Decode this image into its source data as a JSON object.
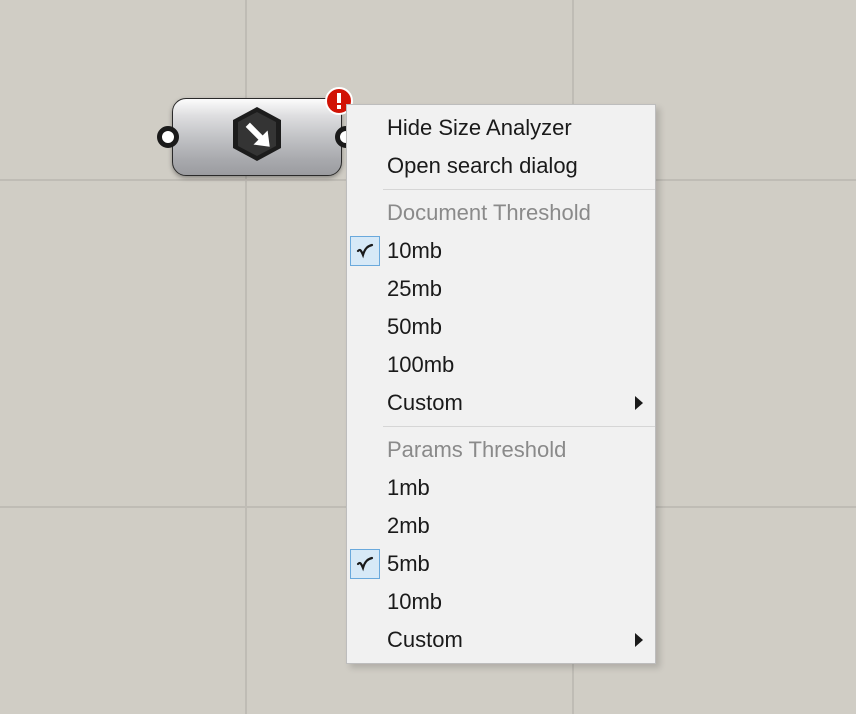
{
  "menu": {
    "hide": "Hide Size Analyzer",
    "opensearch": "Open search dialog",
    "docHeader": "Document Threshold",
    "docItems": [
      "10mb",
      "25mb",
      "50mb",
      "100mb"
    ],
    "docCustom": "Custom",
    "docChecked": 0,
    "paramsHeader": "Params Threshold",
    "paramsItems": [
      "1mb",
      "2mb",
      "5mb",
      "10mb"
    ],
    "paramsCustom": "Custom",
    "paramsChecked": 2
  }
}
